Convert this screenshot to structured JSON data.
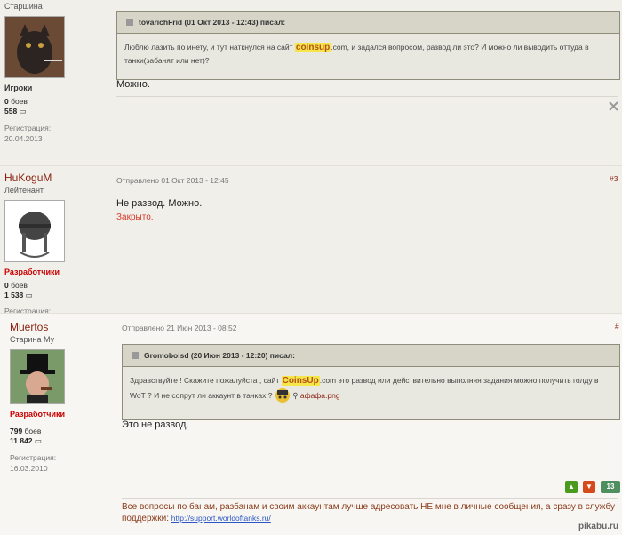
{
  "post1": {
    "rank": "Старшина",
    "group": "Игроки",
    "battles_value": "0",
    "battles_label": "боев",
    "messages": "558",
    "reg_label": "Регистрация:",
    "reg_date": "20.04.2013",
    "quote": {
      "header": "tovarichFrid (01 Окт 2013 - 12:43) писал:",
      "before": "Люблю лазить по инету, и тут наткнулся на сайт ",
      "highlight": "coinsup",
      "after": ".com, и задался вопросом, развод ли это? И можно ли выводить оттуда в танки(забанят или нет)?"
    },
    "text": "Можно."
  },
  "post2": {
    "nick": "HuKoguM",
    "rank": "Лейтенант",
    "group": "Разработчики",
    "battles_value": "0",
    "battles_label": "боев",
    "messages": "1 538",
    "reg_label": "Регистрация:",
    "posted": "Отправлено 01 Окт 2013 - 12:45",
    "number": "#3",
    "text": "Не развод. Можно.",
    "closed": "Закрыто."
  },
  "post3": {
    "nick": "Muertos",
    "rank": "Старина Му",
    "group": "Разработчики",
    "battles_value": "799",
    "battles_label": "боев",
    "messages": "11 842",
    "reg_label": "Регистрация:",
    "reg_date": "16.03.2010",
    "posted": "Отправлено 21 Июн 2013 - 08:52",
    "number": "#",
    "quote": {
      "header": "Gromoboisd (20 Июн 2013 - 12:20) писал:",
      "before": "Здравствуйте ! Скажите пожалуйста , сайт ",
      "highlight": "CoinsUp",
      "after": ".com это развод или действительно выполняя задания можно получить голду  в WoT ? И не сопрут ли аккаунт в танках ?",
      "attachment": "афафа.png"
    },
    "text": "Это не развод.",
    "score": "13",
    "signature": "Все вопросы по банам, разбанам и своим аккаунтам лучше адресовать НЕ мне в личные сообщения, а сразу в службу поддержки:",
    "link": "http://support.worldoftanks.ru/"
  },
  "watermark": "pikabu.ru"
}
